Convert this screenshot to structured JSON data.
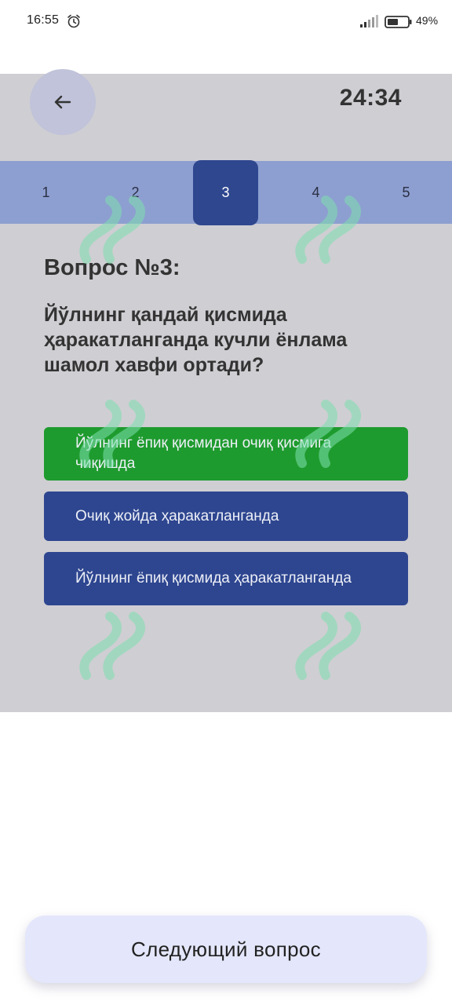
{
  "status_bar": {
    "time": "16:55",
    "battery_percent": "49%",
    "icons": [
      "alarm-icon",
      "signal-icon",
      "battery-icon"
    ]
  },
  "header": {
    "back_icon": "arrow-left-icon",
    "timer": "24:34"
  },
  "question_nav": {
    "tabs": [
      {
        "label": "1",
        "active": false
      },
      {
        "label": "2",
        "active": false
      },
      {
        "label": "3",
        "active": true
      },
      {
        "label": "4",
        "active": false
      },
      {
        "label": "5",
        "active": false
      }
    ]
  },
  "question": {
    "number_label": "Вопрос №3:",
    "text": "Йўлнинг қандай қисмида ҳаракатланганда кучли ёнлама шамол хавфи ортади?"
  },
  "answers": [
    {
      "text": "Йўлнинг ёпиқ қисмидан очиқ қисмига чиқишда",
      "state": "correct"
    },
    {
      "text": "Очиқ жойда ҳаракатланганда",
      "state": "normal"
    },
    {
      "text": "Йўлнинг ёпиқ қисмида ҳаракатланганда",
      "state": "normal"
    }
  ],
  "footer": {
    "next_label": "Следующий вопрос"
  },
  "colors": {
    "panel_bg": "#cfced3",
    "nav_bg": "#8d9fd0",
    "active_tab": "#2f478f",
    "correct_answer": "#1e9b2e",
    "answer_bg": "#2e4690",
    "next_button_bg": "#e4e7fb"
  }
}
